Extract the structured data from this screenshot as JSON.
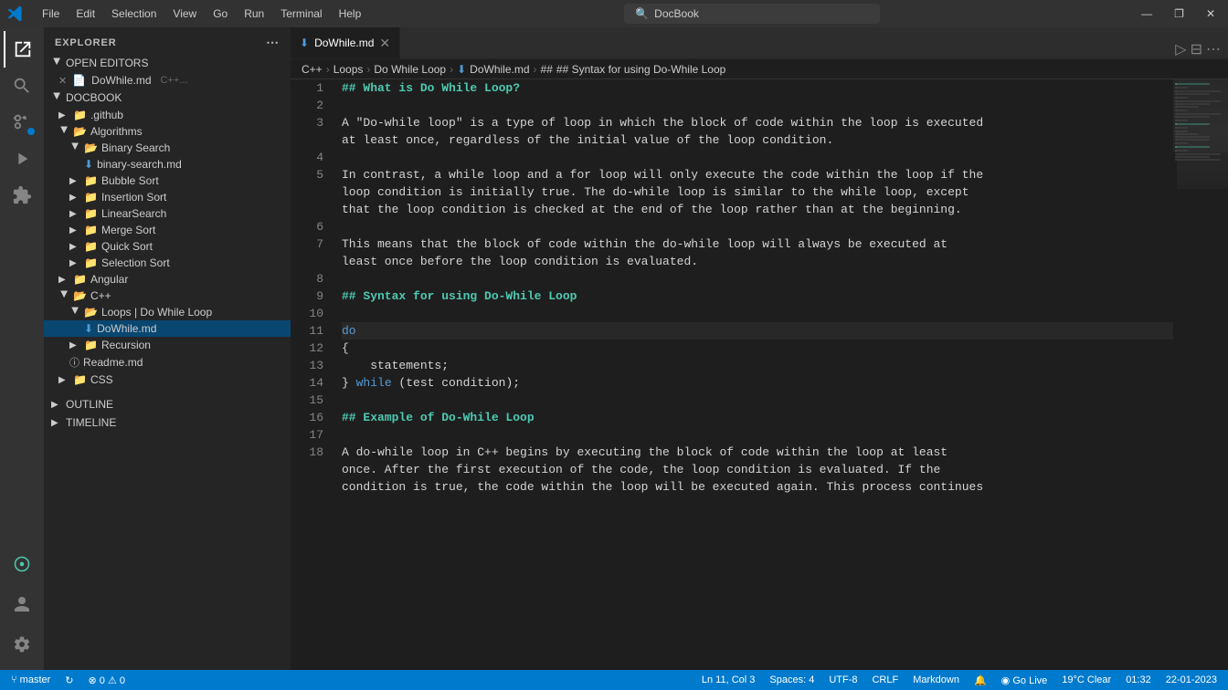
{
  "titleBar": {
    "logo": "vscode-logo",
    "menus": [
      "File",
      "Edit",
      "Selection",
      "View",
      "Go",
      "Run",
      "Terminal",
      "Help"
    ],
    "searchPlaceholder": "DocBook",
    "windowControls": [
      "minimize",
      "restore",
      "close"
    ]
  },
  "activityBar": {
    "items": [
      {
        "name": "explorer",
        "icon": "⬜",
        "active": true
      },
      {
        "name": "search",
        "icon": "🔍"
      },
      {
        "name": "source-control",
        "icon": "⑂",
        "badge": true
      },
      {
        "name": "run-debug",
        "icon": "▷"
      },
      {
        "name": "extensions",
        "icon": "⊞"
      }
    ],
    "bottom": [
      {
        "name": "remote",
        "icon": "⊙"
      },
      {
        "name": "account",
        "icon": "👤"
      },
      {
        "name": "settings",
        "icon": "⚙"
      }
    ]
  },
  "sidebar": {
    "title": "EXPLORER",
    "openEditors": {
      "label": "OPEN EDITORS",
      "items": [
        {
          "name": "DoWhile.md",
          "path": "C++...",
          "icon": "md"
        }
      ]
    },
    "docbook": {
      "label": "DOCBOOK",
      "items": [
        {
          "label": ".github",
          "type": "folder",
          "level": 1
        },
        {
          "label": "Algorithms",
          "type": "folder",
          "level": 1,
          "open": true,
          "children": [
            {
              "label": "Binary Search",
              "type": "folder",
              "level": 2,
              "open": true,
              "children": [
                {
                  "label": "binary-search.md",
                  "type": "file",
                  "level": 3,
                  "icon": "md"
                }
              ]
            },
            {
              "label": "Bubble Sort",
              "type": "folder",
              "level": 2
            },
            {
              "label": "Insertion Sort",
              "type": "folder",
              "level": 2
            },
            {
              "label": "LinearSearch",
              "type": "folder",
              "level": 2
            },
            {
              "label": "Merge Sort",
              "type": "folder",
              "level": 2
            },
            {
              "label": "Quick Sort",
              "type": "folder",
              "level": 2
            },
            {
              "label": "Selection Sort",
              "type": "folder",
              "level": 2
            }
          ]
        },
        {
          "label": "Angular",
          "type": "folder",
          "level": 1
        },
        {
          "label": "C++",
          "type": "folder",
          "level": 1,
          "open": true,
          "children": [
            {
              "label": "Loops \\ Do While Loop",
              "type": "folder",
              "level": 2,
              "open": true,
              "children": [
                {
                  "label": "DoWhile.md",
                  "type": "file",
                  "level": 3,
                  "icon": "md",
                  "selected": true
                }
              ]
            },
            {
              "label": "Recursion",
              "type": "folder",
              "level": 2
            },
            {
              "label": "Readme.md",
              "type": "file-root",
              "level": 2,
              "icon": "info"
            }
          ]
        },
        {
          "label": "CSS",
          "type": "folder",
          "level": 1
        }
      ]
    },
    "outline": {
      "label": "OUTLINE"
    },
    "timeline": {
      "label": "TIMELINE"
    }
  },
  "tabs": [
    {
      "label": "DoWhile.md",
      "icon": "md",
      "active": true,
      "modified": false
    }
  ],
  "breadcrumb": {
    "parts": [
      "C++",
      "Loops",
      "Do While Loop",
      "DoWhile.md",
      "## Syntax for using Do-While Loop"
    ]
  },
  "editor": {
    "filename": "DoWhile.md",
    "lines": [
      {
        "num": 1,
        "content": "## What is Do While Loop?",
        "type": "h2"
      },
      {
        "num": 2,
        "content": "",
        "type": "empty"
      },
      {
        "num": 3,
        "content": "A \"Do-while loop\" is a type of loop in which the block of code within the loop is executed",
        "type": "text"
      },
      {
        "num": 3,
        "content": "at least once, regardless of the initial value of the loop condition.",
        "type": "text-cont"
      },
      {
        "num": 4,
        "content": "",
        "type": "empty"
      },
      {
        "num": 5,
        "content": "In contrast, a while loop and a for loop will only execute the code within the loop if the",
        "type": "text"
      },
      {
        "num": 5,
        "content": "loop condition is initially true. The do-while loop is similar to the while loop, except",
        "type": "text-cont"
      },
      {
        "num": 5,
        "content": "that the loop condition is checked at the end of the loop rather than at the beginning.",
        "type": "text-cont"
      },
      {
        "num": 6,
        "content": "",
        "type": "empty"
      },
      {
        "num": 7,
        "content": "This means that the block of code within the do-while loop will always be executed at",
        "type": "text"
      },
      {
        "num": 7,
        "content": "least once before the loop condition is evaluated.",
        "type": "text-cont"
      },
      {
        "num": 8,
        "content": "",
        "type": "empty"
      },
      {
        "num": 9,
        "content": "## Syntax for using Do-While Loop",
        "type": "h2"
      },
      {
        "num": 10,
        "content": "",
        "type": "empty"
      },
      {
        "num": 11,
        "content": "do",
        "type": "code",
        "active": true
      },
      {
        "num": 12,
        "content": "{",
        "type": "code"
      },
      {
        "num": 13,
        "content": "    statements;",
        "type": "code"
      },
      {
        "num": 14,
        "content": "} while (test condition);",
        "type": "code"
      },
      {
        "num": 15,
        "content": "",
        "type": "empty"
      },
      {
        "num": 16,
        "content": "## Example of Do-While Loop",
        "type": "h2"
      },
      {
        "num": 17,
        "content": "",
        "type": "empty"
      },
      {
        "num": 18,
        "content": "A do-while loop in C++ begins by executing the block of code within the loop at least",
        "type": "text"
      },
      {
        "num": 18,
        "content": "once. After the first execution of the code, the loop condition is evaluated. If the",
        "type": "text-cont"
      },
      {
        "num": 18,
        "content": "condition is true, the code within the loop will be executed again. This process continues",
        "type": "text-cont"
      }
    ]
  },
  "statusBar": {
    "branch": "master",
    "sync": "↻",
    "errors": "0",
    "warnings": "0",
    "position": "Ln 11, Col 3",
    "spaces": "Spaces: 4",
    "encoding": "UTF-8",
    "lineEnding": "CRLF",
    "language": "Markdown",
    "goLive": "Go Live",
    "notifications": "",
    "time": "01:32",
    "date": "22-01-2023",
    "temperature": "19°C Clear"
  }
}
